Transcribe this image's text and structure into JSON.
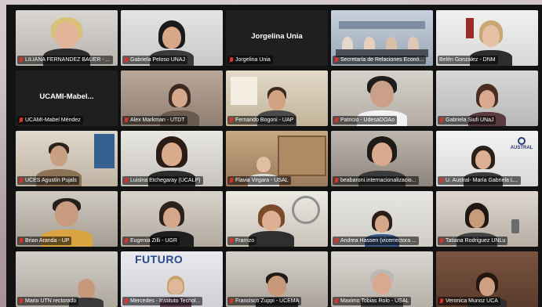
{
  "participants": [
    {
      "name": "LILIANA FERNANDEZ BAUER - ...",
      "muted": true
    },
    {
      "name": "Gabriela Peloso UNAJ",
      "muted": true
    },
    {
      "name": "Jorgelina Unia",
      "muted": true,
      "display_name": "Jorgelina Unia"
    },
    {
      "name": "Secretaría de Relaciones Econó...",
      "muted": true
    },
    {
      "name": "Belén González - DNM",
      "muted": false
    },
    {
      "name": "UCAMI-Mabel Méndez",
      "muted": true,
      "display_name": "UCAMI-Mabel..."
    },
    {
      "name": "Alex Markman - UTDT",
      "muted": true
    },
    {
      "name": "Fernando Bogoni - UAP",
      "muted": true
    },
    {
      "name": "Patricio - UdesaDOAo",
      "muted": true
    },
    {
      "name": "Gabriela Siufi UNaJ",
      "muted": true
    },
    {
      "name": "UCES Agustín Pujals",
      "muted": true
    },
    {
      "name": "Luisina Etchegaray (UCALP)",
      "muted": true
    },
    {
      "name": "Flavia Virgara - USAL",
      "muted": true
    },
    {
      "name": "beabaroni.internacionalizacio...",
      "muted": true
    },
    {
      "name": "U. Austral- María Gabriela L...",
      "muted": true
    },
    {
      "name": "Brian Aranda - UP",
      "muted": true
    },
    {
      "name": "Eugenia Zilli - UGR",
      "muted": true
    },
    {
      "name": "Frarrizo",
      "muted": true
    },
    {
      "name": "Andrea Hassen (vicerrectora ...",
      "muted": true
    },
    {
      "name": "Tatiana Rodriguez UNLu",
      "muted": true
    },
    {
      "name": "Mario UTN rectorado",
      "muted": true
    },
    {
      "name": "Mercedes - Instituto Tecnol...",
      "muted": true
    },
    {
      "name": "Francisco Zuppi - UCEMA",
      "muted": true
    },
    {
      "name": "Maximo Tobias Rolo - USAL",
      "muted": true
    },
    {
      "name": "Veronica Munoz UCA",
      "muted": true
    }
  ],
  "active_speaker": "Belén González - DNM",
  "tile_text": {
    "futuro": "FUTURO",
    "austral": "AUSTRAL"
  }
}
